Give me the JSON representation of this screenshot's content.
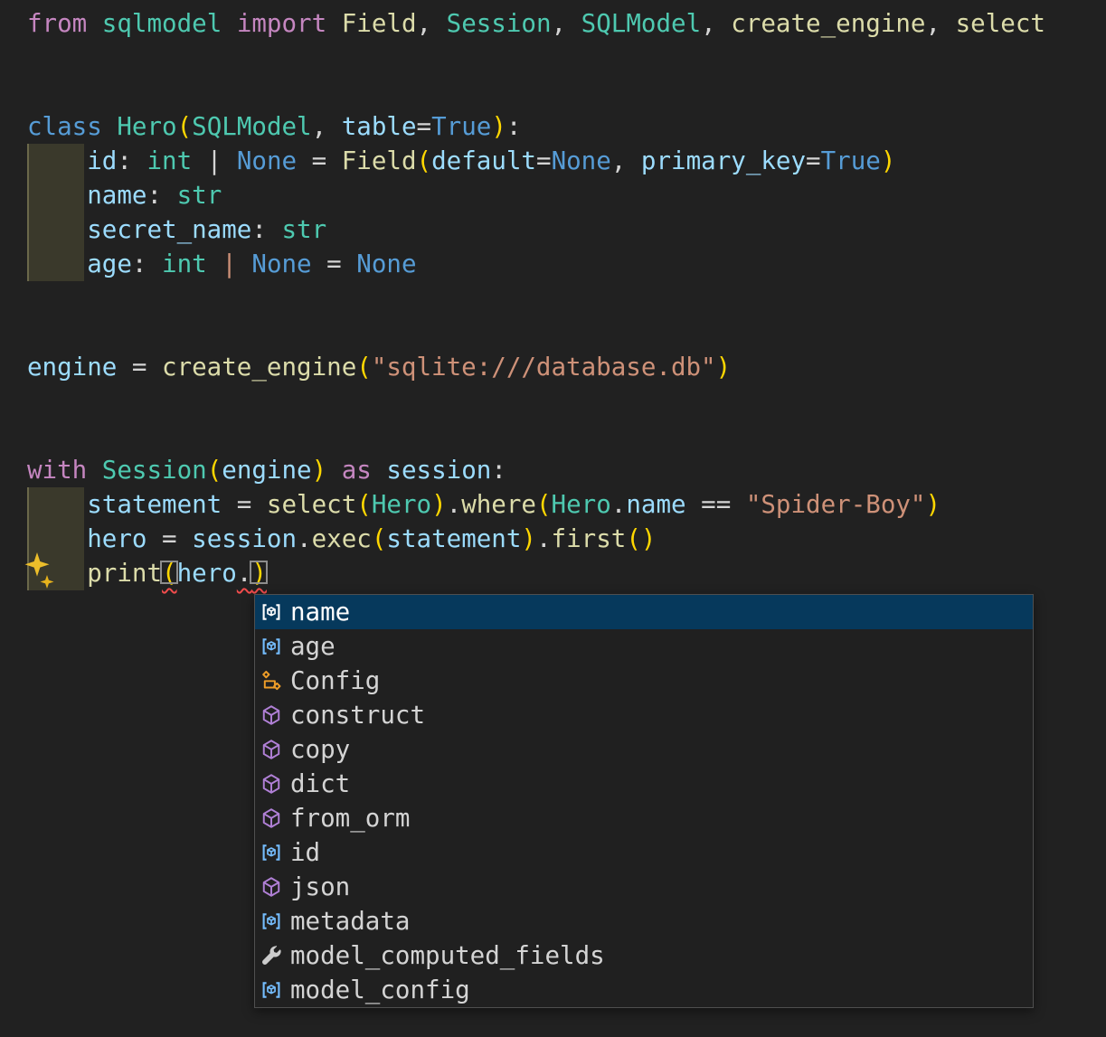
{
  "theme": {
    "editor_background": "#212121",
    "indent_highlight": "#3a392b",
    "token_colors": {
      "keyword_control": "#c586c0",
      "keyword_blue": "#569cd6",
      "type_class": "#4ec9b0",
      "function_call": "#dcdcaa",
      "variable": "#9cdcfe",
      "punctuation": "#d4d4d4",
      "bracket_gold": "#ffd700",
      "string": "#ce9178",
      "orange_pipe": "#ce9178"
    },
    "error_squiggle": "#f14c4c",
    "bracket_match_border": "#8d8d8d",
    "sparkle_gold": "#ecbe2a",
    "suggest_background": "#202020",
    "suggest_border": "#4f4f4f",
    "suggest_selected_background": "#06395c",
    "suggest_text": "#d4d4d4",
    "suggest_selected_text": "#ffffff",
    "icon_colors": {
      "field": "#75beff",
      "class": "#ee9d28",
      "method": "#b180d7",
      "property": "#cccccc",
      "selected": "#ffffff"
    }
  },
  "editor": {
    "lines": [
      {
        "tokens": [
          {
            "t": "from",
            "s": "k"
          },
          {
            "t": " ",
            "s": "p"
          },
          {
            "t": "sqlmodel",
            "s": "t"
          },
          {
            "t": " ",
            "s": "p"
          },
          {
            "t": "import",
            "s": "k"
          },
          {
            "t": " ",
            "s": "p"
          },
          {
            "t": "Field",
            "s": "f"
          },
          {
            "t": ", ",
            "s": "p"
          },
          {
            "t": "Session",
            "s": "t"
          },
          {
            "t": ", ",
            "s": "p"
          },
          {
            "t": "SQLModel",
            "s": "t"
          },
          {
            "t": ", ",
            "s": "p"
          },
          {
            "t": "create_engine",
            "s": "f"
          },
          {
            "t": ", ",
            "s": "p"
          },
          {
            "t": "select",
            "s": "f"
          }
        ]
      },
      {
        "tokens": []
      },
      {
        "tokens": []
      },
      {
        "tokens": [
          {
            "t": "class",
            "s": "b"
          },
          {
            "t": " ",
            "s": "p"
          },
          {
            "t": "Hero",
            "s": "t"
          },
          {
            "t": "(",
            "s": "g"
          },
          {
            "t": "SQLModel",
            "s": "t"
          },
          {
            "t": ", ",
            "s": "p"
          },
          {
            "t": "table",
            "s": "v"
          },
          {
            "t": "=",
            "s": "p"
          },
          {
            "t": "True",
            "s": "b"
          },
          {
            "t": ")",
            "s": "g"
          },
          {
            "t": ":",
            "s": "p"
          }
        ]
      },
      {
        "tokens": [
          {
            "t": "    ",
            "s": "p"
          },
          {
            "t": "id",
            "s": "v"
          },
          {
            "t": ": ",
            "s": "p"
          },
          {
            "t": "int",
            "s": "t"
          },
          {
            "t": " | ",
            "s": "p"
          },
          {
            "t": "None",
            "s": "b"
          },
          {
            "t": " = ",
            "s": "p"
          },
          {
            "t": "Field",
            "s": "f"
          },
          {
            "t": "(",
            "s": "g"
          },
          {
            "t": "default",
            "s": "v"
          },
          {
            "t": "=",
            "s": "p"
          },
          {
            "t": "None",
            "s": "b"
          },
          {
            "t": ", ",
            "s": "p"
          },
          {
            "t": "primary_key",
            "s": "v"
          },
          {
            "t": "=",
            "s": "p"
          },
          {
            "t": "True",
            "s": "b"
          },
          {
            "t": ")",
            "s": "g"
          }
        ]
      },
      {
        "tokens": [
          {
            "t": "    ",
            "s": "p"
          },
          {
            "t": "name",
            "s": "v"
          },
          {
            "t": ": ",
            "s": "p"
          },
          {
            "t": "str",
            "s": "t"
          }
        ]
      },
      {
        "tokens": [
          {
            "t": "    ",
            "s": "p"
          },
          {
            "t": "secret_name",
            "s": "v"
          },
          {
            "t": ": ",
            "s": "p"
          },
          {
            "t": "str",
            "s": "t"
          }
        ]
      },
      {
        "tokens": [
          {
            "t": "    ",
            "s": "p"
          },
          {
            "t": "age",
            "s": "v"
          },
          {
            "t": ": ",
            "s": "p"
          },
          {
            "t": "int",
            "s": "t"
          },
          {
            "t": " ",
            "s": "p"
          },
          {
            "t": "|",
            "s": "o"
          },
          {
            "t": " ",
            "s": "p"
          },
          {
            "t": "None",
            "s": "b"
          },
          {
            "t": " = ",
            "s": "p"
          },
          {
            "t": "None",
            "s": "b"
          }
        ]
      },
      {
        "tokens": []
      },
      {
        "tokens": []
      },
      {
        "tokens": [
          {
            "t": "engine",
            "s": "v"
          },
          {
            "t": " = ",
            "s": "p"
          },
          {
            "t": "create_engine",
            "s": "f"
          },
          {
            "t": "(",
            "s": "g"
          },
          {
            "t": "\"sqlite:///database.db\"",
            "s": "s"
          },
          {
            "t": ")",
            "s": "g"
          }
        ]
      },
      {
        "tokens": []
      },
      {
        "tokens": []
      },
      {
        "tokens": [
          {
            "t": "with",
            "s": "k"
          },
          {
            "t": " ",
            "s": "p"
          },
          {
            "t": "Session",
            "s": "t"
          },
          {
            "t": "(",
            "s": "g"
          },
          {
            "t": "engine",
            "s": "v"
          },
          {
            "t": ")",
            "s": "g"
          },
          {
            "t": " ",
            "s": "p"
          },
          {
            "t": "as",
            "s": "k"
          },
          {
            "t": " ",
            "s": "p"
          },
          {
            "t": "session",
            "s": "v"
          },
          {
            "t": ":",
            "s": "p"
          }
        ]
      },
      {
        "tokens": [
          {
            "t": "    ",
            "s": "p"
          },
          {
            "t": "statement",
            "s": "v"
          },
          {
            "t": " = ",
            "s": "p"
          },
          {
            "t": "select",
            "s": "f"
          },
          {
            "t": "(",
            "s": "g"
          },
          {
            "t": "Hero",
            "s": "t"
          },
          {
            "t": ")",
            "s": "g"
          },
          {
            "t": ".",
            "s": "p"
          },
          {
            "t": "where",
            "s": "f"
          },
          {
            "t": "(",
            "s": "g"
          },
          {
            "t": "Hero",
            "s": "t"
          },
          {
            "t": ".",
            "s": "p"
          },
          {
            "t": "name",
            "s": "v"
          },
          {
            "t": " == ",
            "s": "p"
          },
          {
            "t": "\"Spider-Boy\"",
            "s": "s"
          },
          {
            "t": ")",
            "s": "g"
          }
        ]
      },
      {
        "tokens": [
          {
            "t": "    ",
            "s": "p"
          },
          {
            "t": "hero",
            "s": "v"
          },
          {
            "t": " = ",
            "s": "p"
          },
          {
            "t": "session",
            "s": "v"
          },
          {
            "t": ".",
            "s": "p"
          },
          {
            "t": "exec",
            "s": "f"
          },
          {
            "t": "(",
            "s": "g"
          },
          {
            "t": "statement",
            "s": "v"
          },
          {
            "t": ")",
            "s": "g"
          },
          {
            "t": ".",
            "s": "p"
          },
          {
            "t": "first",
            "s": "f"
          },
          {
            "t": "(",
            "s": "g"
          },
          {
            "t": ")",
            "s": "g"
          }
        ]
      },
      {
        "tokens": [
          {
            "t": "    ",
            "s": "p"
          },
          {
            "t": "print",
            "s": "f"
          },
          {
            "t": "(",
            "s": "g",
            "box": true,
            "err": true
          },
          {
            "t": "hero",
            "s": "v"
          },
          {
            "t": ".",
            "s": "p",
            "err": true
          },
          {
            "t": ")",
            "s": "g",
            "box": true,
            "err": true
          }
        ]
      }
    ]
  },
  "gutter": {
    "sparkle_icon": "copilot-sparkle-icon"
  },
  "suggest": {
    "selected_index": 0,
    "items": [
      {
        "label": "name",
        "kind": "field",
        "icon": "symbol-field-icon"
      },
      {
        "label": "age",
        "kind": "field",
        "icon": "symbol-field-icon"
      },
      {
        "label": "Config",
        "kind": "class",
        "icon": "symbol-class-icon"
      },
      {
        "label": "construct",
        "kind": "method",
        "icon": "symbol-method-icon"
      },
      {
        "label": "copy",
        "kind": "method",
        "icon": "symbol-method-icon"
      },
      {
        "label": "dict",
        "kind": "method",
        "icon": "symbol-method-icon"
      },
      {
        "label": "from_orm",
        "kind": "method",
        "icon": "symbol-method-icon"
      },
      {
        "label": "id",
        "kind": "field",
        "icon": "symbol-field-icon"
      },
      {
        "label": "json",
        "kind": "method",
        "icon": "symbol-method-icon"
      },
      {
        "label": "metadata",
        "kind": "field",
        "icon": "symbol-field-icon"
      },
      {
        "label": "model_computed_fields",
        "kind": "property",
        "icon": "symbol-property-wrench-icon"
      },
      {
        "label": "model_config",
        "kind": "field",
        "icon": "symbol-field-icon"
      }
    ]
  }
}
